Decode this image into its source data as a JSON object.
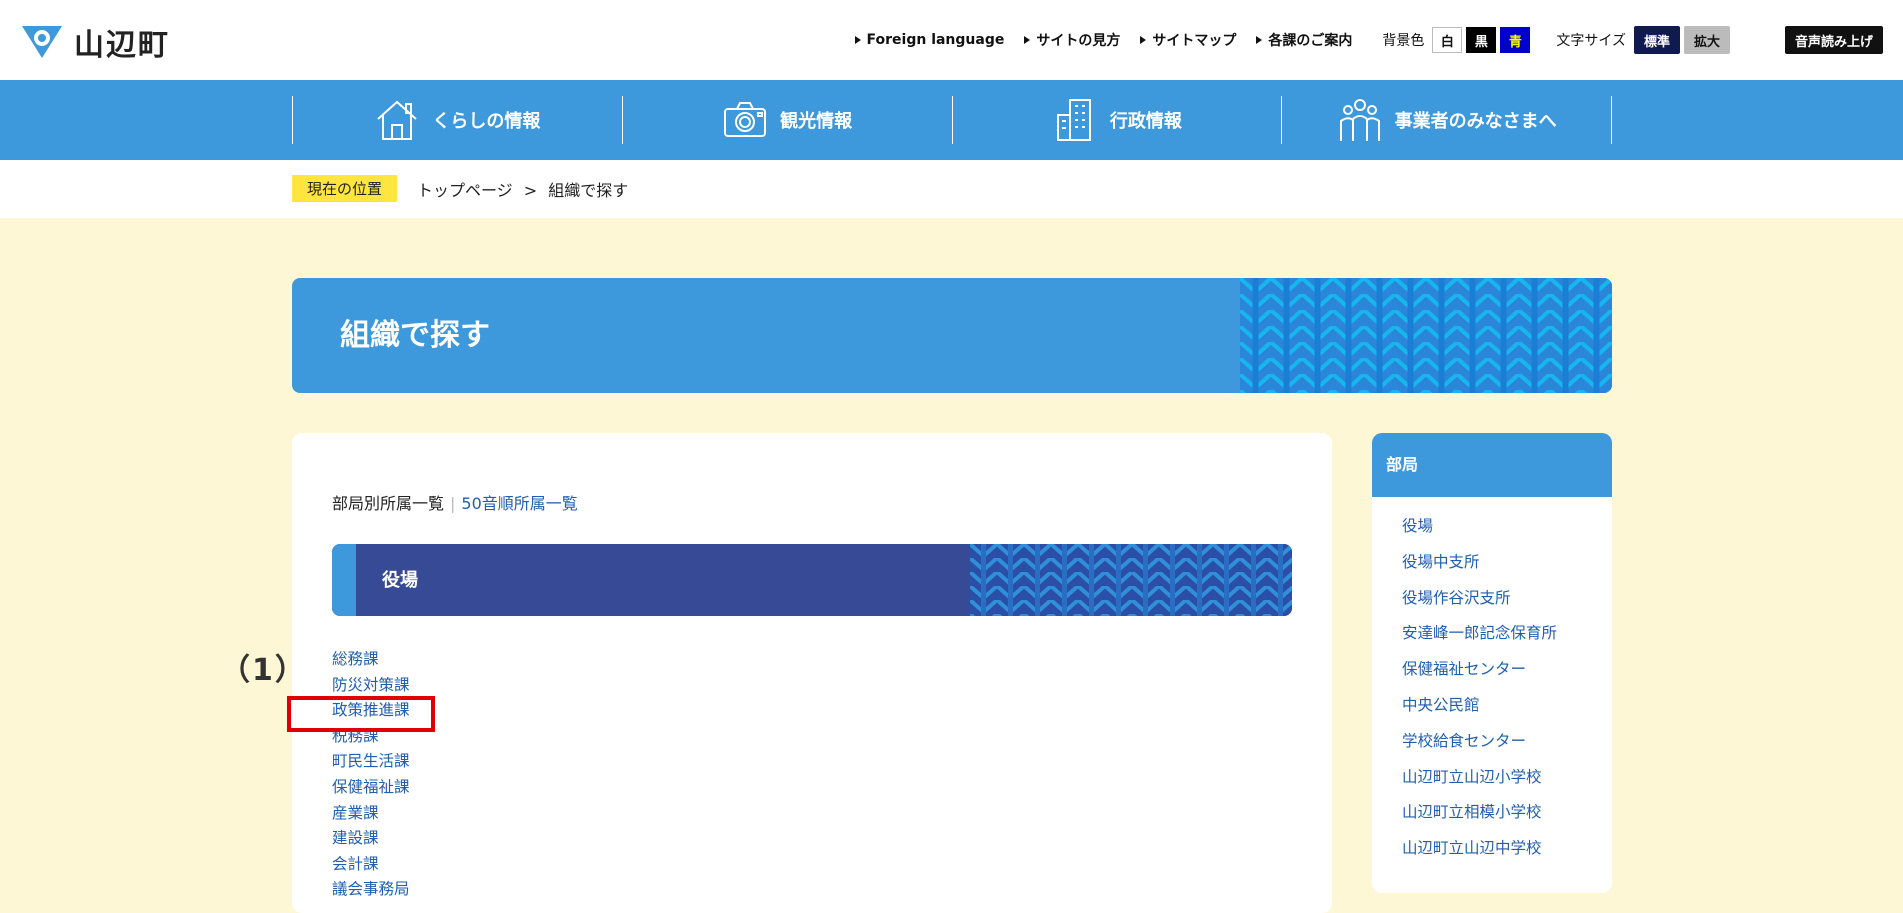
{
  "header": {
    "site_name": "山辺町",
    "links": [
      "Foreign language",
      "サイトの見方",
      "サイトマップ",
      "各課のご案内"
    ],
    "bg_label": "背景色",
    "bg_options": [
      "白",
      "黒",
      "青"
    ],
    "font_label": "文字サイズ",
    "font_options": [
      "標準",
      "拡大"
    ],
    "tts_label": "音声読み上げ"
  },
  "nav": {
    "items": [
      "くらしの情報",
      "観光情報",
      "行政情報",
      "事業者のみなさまへ"
    ]
  },
  "breadcrumb": {
    "tag": "現在の位置",
    "items": [
      "トップページ",
      "組織で探す"
    ],
    "separator": ">"
  },
  "page": {
    "title": "組織で探す"
  },
  "tabs": {
    "current": "部局別所属一覧",
    "separator": "|",
    "alt": "50音順所属一覧"
  },
  "section": {
    "title": "役場",
    "departments": [
      "総務課",
      "防災対策課",
      "政策推進課",
      "税務課",
      "町民生活課",
      "保健福祉課",
      "産業課",
      "建設課",
      "会計課",
      "議会事務局"
    ]
  },
  "annotation": {
    "marker": "（1）"
  },
  "sidebar": {
    "title": "部局",
    "items": [
      "役場",
      "役場中支所",
      "役場作谷沢支所",
      "安達峰一郎記念保育所",
      "保健福祉センター",
      "中央公民館",
      "学校給食センター",
      "山辺町立山辺小学校",
      "山辺町立相模小学校",
      "山辺町立山辺中学校"
    ]
  },
  "colors": {
    "primary": "#3d98dc",
    "section": "#374a96",
    "link": "#1f5fb0",
    "highlight": "#e10000",
    "tag": "#ffe53d",
    "page_bg": "#fdf7d6"
  }
}
